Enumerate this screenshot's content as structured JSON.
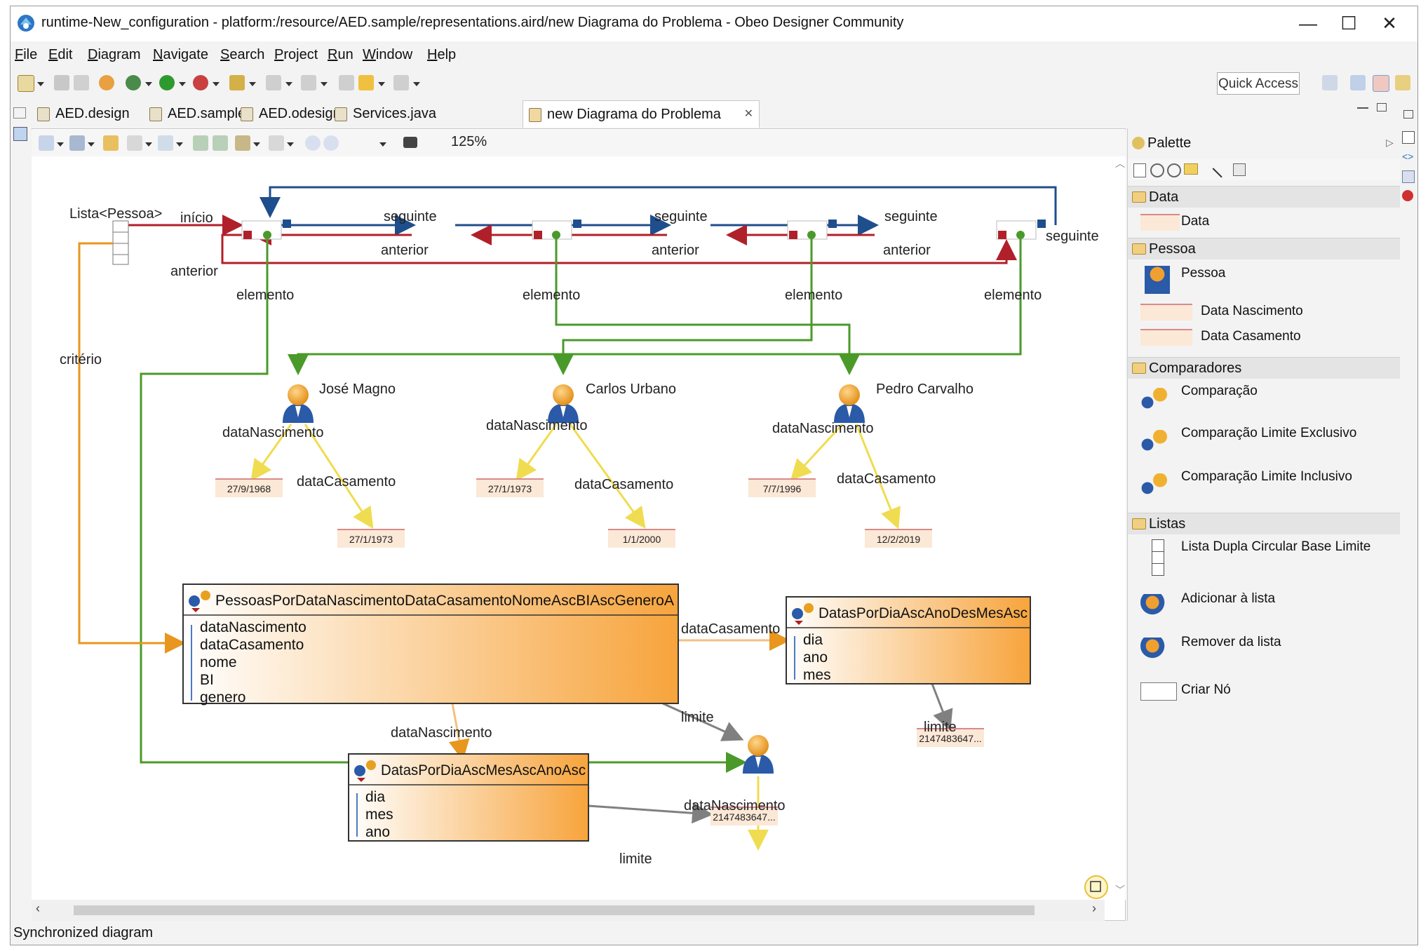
{
  "window": {
    "title": "runtime-New_configuration - platform:/resource/AED.sample/representations.aird/new Diagrama do Problema - Obeo Designer Community",
    "controls": {
      "minimize": "—",
      "maximize": "☐",
      "close": "✕"
    }
  },
  "menu": [
    {
      "mn": "F",
      "rest": "ile"
    },
    {
      "mn": "E",
      "rest": "dit"
    },
    {
      "mn": "D",
      "rest": "iagram"
    },
    {
      "mn": "N",
      "rest": "avigate"
    },
    {
      "mn": "S",
      "rest": "earch"
    },
    {
      "mn": "P",
      "rest": "roject"
    },
    {
      "mn": "R",
      "rest": "un"
    },
    {
      "mn": "W",
      "rest": "indow"
    },
    {
      "mn": "H",
      "rest": "elp"
    }
  ],
  "toolbar": {
    "quick_access": "Quick Access"
  },
  "tabs": [
    {
      "label": "AED.design"
    },
    {
      "label": "AED.sample"
    },
    {
      "label": "AED.odesign"
    },
    {
      "label": "Services.java"
    },
    {
      "label": "new Diagrama do Problema",
      "close": "✕"
    }
  ],
  "diagram_toolbar": {
    "zoom": "125%"
  },
  "diagram": {
    "list_label": "Lista<Pessoa>",
    "edges": {
      "inicio": "início",
      "seguinte": "seguinte",
      "anterior": "anterior",
      "elemento": "elemento",
      "criterio": "critério",
      "dataNascimento": "dataNascimento",
      "dataCasamento": "dataCasamento",
      "limite": "limite"
    },
    "persons": [
      {
        "name": "José Magno",
        "birth": "27/9/1968",
        "marriage": "27/1/1973"
      },
      {
        "name": "Carlos Urbano",
        "birth": "27/1/1973",
        "marriage": "1/1/2000"
      },
      {
        "name": "Pedro Carvalho",
        "birth": "7/7/1996",
        "marriage": "12/2/2019"
      }
    ],
    "comparator_main": {
      "title": "PessoasPorDataNascimentoDataCasamentoNomeAscBIAscGeneroA",
      "attrs": [
        "dataNascimento",
        "dataCasamento",
        "nome",
        "BI",
        "genero"
      ]
    },
    "comparator_right": {
      "title": "DatasPorDiaAscAnoDesMesAsc",
      "attrs": [
        "dia",
        "ano",
        "mes"
      ]
    },
    "comparator_bottom": {
      "title": "DatasPorDiaAscMesAscAnoAsc",
      "attrs": [
        "dia",
        "mes",
        "ano"
      ]
    },
    "limit_right": "2147483647...",
    "limit_bottom": "2147483647..."
  },
  "palette": {
    "title": "Palette",
    "sections": {
      "data": {
        "label": "Data",
        "items": [
          "Data"
        ]
      },
      "pessoa": {
        "label": "Pessoa",
        "items": [
          "Pessoa",
          "Data Nascimento",
          "Data Casamento"
        ]
      },
      "comparadores": {
        "label": "Comparadores",
        "items": [
          "Comparação",
          "Comparação Limite Exclusivo",
          "Comparação Limite Inclusivo"
        ]
      },
      "listas": {
        "label": "Listas",
        "items": [
          "Lista Dupla Circular Base Limite",
          "Adicionar à lista",
          "Remover da lista",
          "Criar Nó"
        ]
      }
    }
  },
  "status": {
    "text": "Synchronized diagram"
  },
  "colors": {
    "blue_edge": "#1f4e8c",
    "red_edge": "#b0202a",
    "green_edge": "#4a9a2a",
    "orange_edge": "#e8961e",
    "yellow_edge": "#f0dc50",
    "gray_edge": "#808080",
    "date_fill": "#fbe8d6",
    "date_line": "#d88a8a",
    "comparator_gradient_end": "#f7a43c"
  }
}
